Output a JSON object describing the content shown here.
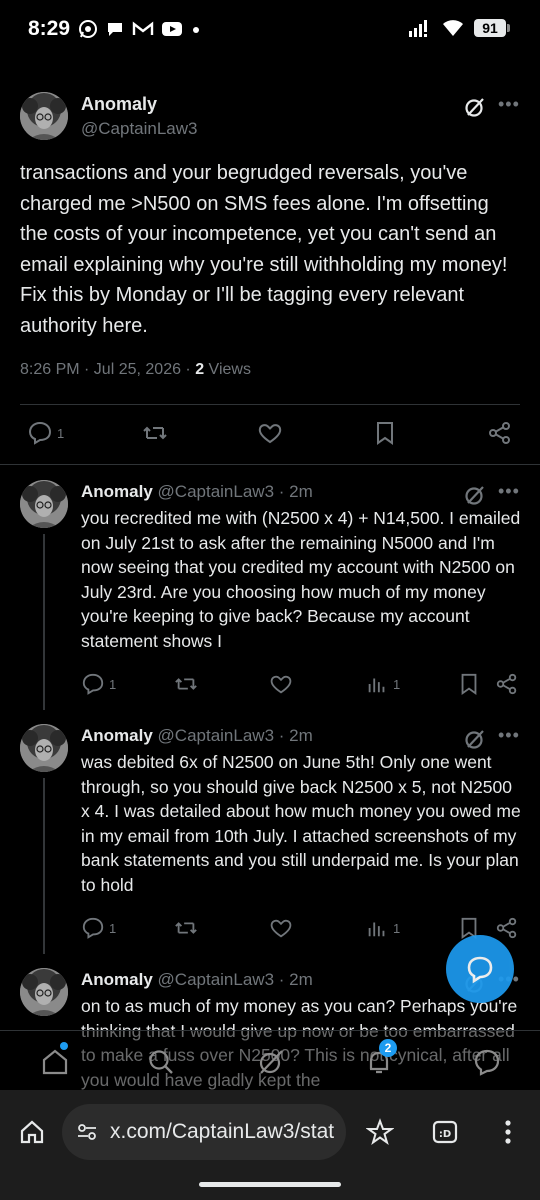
{
  "status_bar": {
    "time": "8:29",
    "battery": "91"
  },
  "main_post": {
    "name": "Anomaly",
    "handle": "@CaptainLaw3",
    "text": "transactions and your begrudged reversals, you've charged me >N500 on SMS fees alone. I'm offsetting the costs of your incompetence, yet you can't send an email explaining why you're still withholding my money! Fix this by Monday or I'll be tagging every relevant authority here.",
    "timestamp": "8:26 PM · Jul 25, 2026 · ",
    "views_count": "2",
    "views_label": " Views",
    "reply_count": "1"
  },
  "replies": [
    {
      "name": "Anomaly",
      "handle": "@CaptainLaw3 · 2m",
      "text": "you recredited me with (N2500 x 4) + N14,500. I emailed on July 21st to ask after the remaining N5000 and I'm now seeing that you credited my account with N2500 on July 23rd. Are you choosing how much of my money you're keeping to give back? Because my account statement shows I",
      "reply_count": "1",
      "views": "1"
    },
    {
      "name": "Anomaly",
      "handle": "@CaptainLaw3 · 2m",
      "text": "was debited 6x of N2500 on June 5th! Only one went through, so you should give back N2500 x 5, not N2500 x 4. I was detailed about how much money you owed me in my email from 10th July. I attached screenshots of my bank statements and you still underpaid me. Is your plan to hold",
      "reply_count": "1",
      "views": "1"
    },
    {
      "name": "Anomaly",
      "handle": "@CaptainLaw3 · 2m",
      "text": "on to as much of my money as you can? Perhaps you're thinking that I would give up now or be too embarrassed to make a fuss over N2500? This is not cynical, after all you would have gladly kept the"
    }
  ],
  "bottom_nav": {
    "notifications_badge": "2"
  },
  "browser": {
    "url": "x.com/CaptainLaw3/stat"
  },
  "colors": {
    "accent": "#1d9bf0",
    "background": "#000000",
    "muted": "#71767b"
  }
}
